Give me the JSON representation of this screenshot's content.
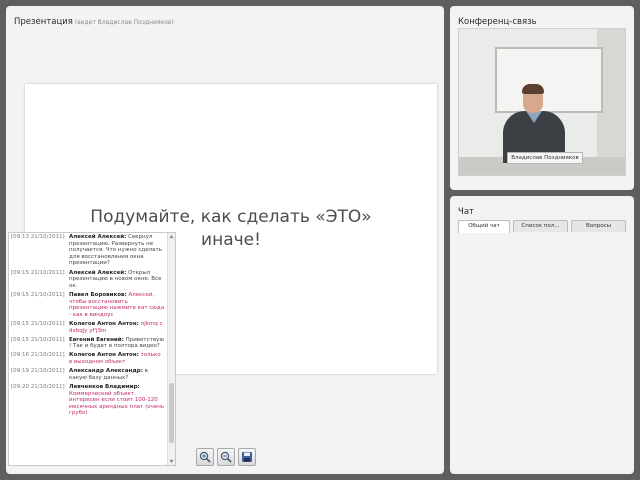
{
  "presentation": {
    "title": "Презентация",
    "subtitle": "(ведет Владислав Позднияков)",
    "slide_text": "Подумайте, как сделать «ЭТО» иначе!"
  },
  "video": {
    "title": "Конференц-связь",
    "caption": "Владислав Позднияков"
  },
  "chat": {
    "title": "Чат",
    "tabs": [
      {
        "label": "Общий чат",
        "active": true
      },
      {
        "label": "Список пол...",
        "active": false
      },
      {
        "label": "Вопросы",
        "active": false
      }
    ],
    "messages": [
      {
        "time": "[09:13 21/10/2011]",
        "author": "Алексей Алексей:",
        "text": "Свернул презентацию. Развернуть не получается. Что нужно сделать для восстановления окна презентации?",
        "color": "plain"
      },
      {
        "time": "[09:15 21/10/2011]",
        "author": "Алексей Алексей:",
        "text": "Открыл презентацию в новом окне. Все ок.",
        "color": "plain"
      },
      {
        "time": "[09:15 21/10/2011]",
        "author": "Павел Боровиков:",
        "text": "Алексей, чтобы восстановить презентацию нажмите кат сюда - как в виндоус",
        "color": "pink"
      },
      {
        "time": "[09:15 21/10/2011]",
        "author": "Колегов Антон Антон:",
        "text": "пjkmq с dxbqjy yf'j3m",
        "color": "pink"
      },
      {
        "time": "[09:15 21/10/2011]",
        "author": "Евгений Евгений:",
        "text": "Приветствую ! Так и будет в полтора видео?",
        "color": "plain"
      },
      {
        "time": "[09:16 21/10/2011]",
        "author": "Колегов Антон Антон:",
        "text": "только в выходном объект",
        "color": "pink"
      },
      {
        "time": "[09:19 21/10/2011]",
        "author": "Александр Александр:",
        "text": "в какую базу данных?",
        "color": "plain"
      },
      {
        "time": "[09:20 21/10/2011]",
        "author": "Левченков Владимир:",
        "text": "Коммерческий объект интересен если стоит 100-120 месячных арендных плат (очень грубо)",
        "color": "pink"
      }
    ]
  },
  "icons": {
    "zoom_in": "zoom-in-icon",
    "zoom_out": "zoom-out-icon",
    "save": "save-icon"
  }
}
